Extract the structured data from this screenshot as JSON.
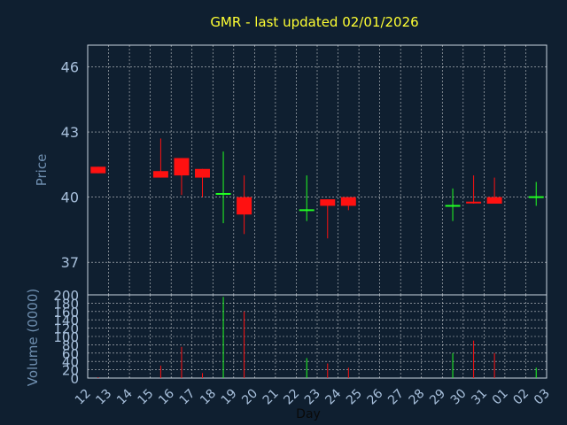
{
  "chart_data": [
    {
      "type": "candlestick",
      "title": "GMR - last updated 02/01/2026",
      "ylabel": "Price",
      "ylim": [
        35.5,
        47
      ],
      "yticks": [
        37,
        40,
        43,
        46
      ],
      "grid": true,
      "colors": {
        "up": "#22ff22",
        "down": "#ff1111",
        "title": "#ffff33",
        "axis_label": "#6f8fb0",
        "tick_label": "#a8c0dc",
        "background": "#0f1f30",
        "grid": "#ffffff"
      },
      "candles": [
        {
          "day": 0,
          "open": 41.4,
          "close": 41.1,
          "high": 41.4,
          "low": 41.1
        },
        {
          "day": 3,
          "open": 41.2,
          "close": 40.9,
          "high": 42.7,
          "low": 40.9
        },
        {
          "day": 4,
          "open": 41.8,
          "close": 41.0,
          "high": 41.8,
          "low": 40.1
        },
        {
          "day": 5,
          "open": 41.3,
          "close": 40.9,
          "high": 41.3,
          "low": 40.0
        },
        {
          "day": 6,
          "open": 40.1,
          "close": 40.2,
          "high": 42.1,
          "low": 38.8
        },
        {
          "day": 7,
          "open": 40.0,
          "close": 39.2,
          "high": 41.0,
          "low": 38.3
        },
        {
          "day": 10,
          "open": 39.4,
          "close": 39.4,
          "high": 41.0,
          "low": 38.9
        },
        {
          "day": 11,
          "open": 39.9,
          "close": 39.6,
          "high": 39.9,
          "low": 38.1
        },
        {
          "day": 12,
          "open": 40.0,
          "close": 39.6,
          "high": 40.0,
          "low": 39.4
        },
        {
          "day": 17,
          "open": 39.6,
          "close": 39.6,
          "high": 40.4,
          "low": 38.9
        },
        {
          "day": 18,
          "open": 39.8,
          "close": 39.7,
          "high": 41.0,
          "low": 39.7
        },
        {
          "day": 19,
          "open": 40.0,
          "close": 39.7,
          "high": 40.9,
          "low": 39.7
        },
        {
          "day": 21,
          "open": 40.0,
          "close": 40.0,
          "high": 40.7,
          "low": 39.6
        }
      ]
    },
    {
      "type": "bar",
      "ylabel": "Volume (0000)",
      "xlabel": "Day",
      "ylim": [
        0,
        200
      ],
      "yticks": [
        0,
        20,
        40,
        60,
        80,
        100,
        120,
        140,
        160,
        180,
        200
      ],
      "categories": [
        "12",
        "13",
        "14",
        "15",
        "16",
        "17",
        "18",
        "19",
        "20",
        "21",
        "22",
        "23",
        "24",
        "25",
        "26",
        "27",
        "28",
        "29",
        "30",
        "31",
        "01",
        "02",
        "03"
      ],
      "bars": [
        {
          "day": 0,
          "value": 2,
          "direction": "down"
        },
        {
          "day": 3,
          "value": 30,
          "direction": "down"
        },
        {
          "day": 4,
          "value": 75,
          "direction": "down"
        },
        {
          "day": 5,
          "value": 12,
          "direction": "down"
        },
        {
          "day": 6,
          "value": 195,
          "direction": "up"
        },
        {
          "day": 7,
          "value": 160,
          "direction": "down"
        },
        {
          "day": 10,
          "value": 48,
          "direction": "up"
        },
        {
          "day": 11,
          "value": 35,
          "direction": "down"
        },
        {
          "day": 12,
          "value": 25,
          "direction": "down"
        },
        {
          "day": 17,
          "value": 60,
          "direction": "up"
        },
        {
          "day": 18,
          "value": 90,
          "direction": "down"
        },
        {
          "day": 19,
          "value": 60,
          "direction": "down"
        },
        {
          "day": 21,
          "value": 25,
          "direction": "up"
        }
      ]
    }
  ]
}
